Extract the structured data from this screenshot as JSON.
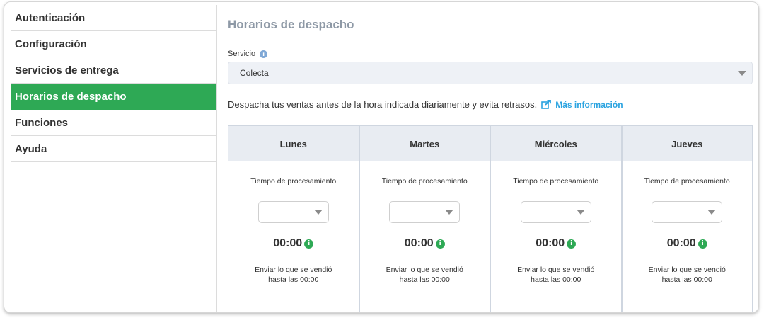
{
  "sidebar": {
    "items": [
      {
        "label": "Autenticación",
        "active": false
      },
      {
        "label": "Configuración",
        "active": false
      },
      {
        "label": "Servicios de entrega",
        "active": false
      },
      {
        "label": "Horarios de despacho",
        "active": true
      },
      {
        "label": "Funciones",
        "active": false
      },
      {
        "label": "Ayuda",
        "active": false
      }
    ]
  },
  "main": {
    "title": "Horarios de despacho",
    "service_label": "Servicio",
    "service_value": "Colecta",
    "description": "Despacha tus ventas antes de la hora indicada diariamente y evita retrasos.",
    "more_info_link": "Más información",
    "days": [
      {
        "name": "Lunes",
        "processing_label": "Tiempo de procesamiento",
        "processing_value": "",
        "time": "00:00",
        "send_line1": "Enviar lo que se vendió",
        "send_line2": "hasta las 00:00"
      },
      {
        "name": "Martes",
        "processing_label": "Tiempo de procesamiento",
        "processing_value": "",
        "time": "00:00",
        "send_line1": "Enviar lo que se vendió",
        "send_line2": "hasta las 00:00"
      },
      {
        "name": "Miércoles",
        "processing_label": "Tiempo de procesamiento",
        "processing_value": "",
        "time": "00:00",
        "send_line1": "Enviar lo que se vendió",
        "send_line2": "hasta las 00:00"
      },
      {
        "name": "Jueves",
        "processing_label": "Tiempo de procesamiento",
        "processing_value": "",
        "time": "00:00",
        "send_line1": "Enviar lo que se vendió",
        "send_line2": "hasta las 00:00"
      }
    ]
  },
  "colors": {
    "active_green": "#2ea955",
    "link_blue": "#2aa3e0",
    "title_gray": "#8e99a6",
    "header_bg": "#e8ecf2"
  }
}
